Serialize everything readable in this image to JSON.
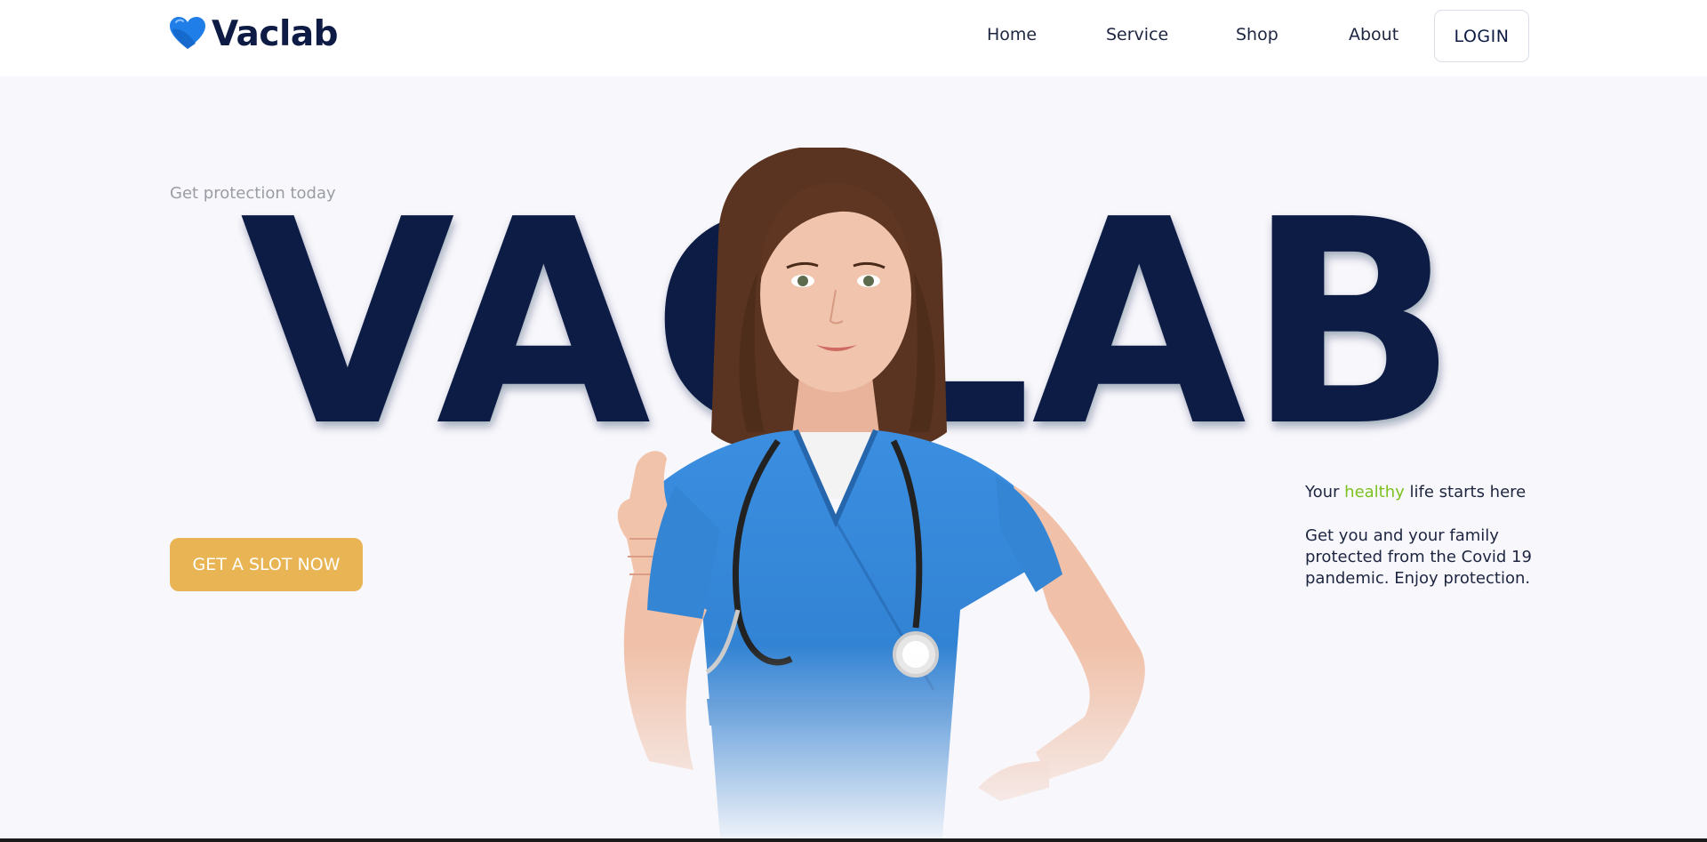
{
  "header": {
    "brand": "Vaclab",
    "nav": [
      {
        "label": "Home"
      },
      {
        "label": "Service"
      },
      {
        "label": "Shop"
      },
      {
        "label": "About"
      }
    ],
    "login_label": "LOGIN"
  },
  "hero": {
    "eyebrow": "Get protection today",
    "big_word": "VACLAB",
    "cta_label": "GET A SLOT NOW",
    "tagline": {
      "before": "Your ",
      "accent": "healthy",
      "after": " life starts here"
    },
    "description": "Get you and your family protected from the Covid 19 pandemic. Enjoy protection."
  },
  "icons": {
    "logo": "heart-icon"
  },
  "colors": {
    "brand_navy": "#0d1b45",
    "accent_green": "#7cc11f",
    "cta_gold": "#e8b454",
    "logo_blue": "#1f7ee8",
    "scrubs_blue": "#2f86d6",
    "hero_bg": "#f8f8fc"
  }
}
